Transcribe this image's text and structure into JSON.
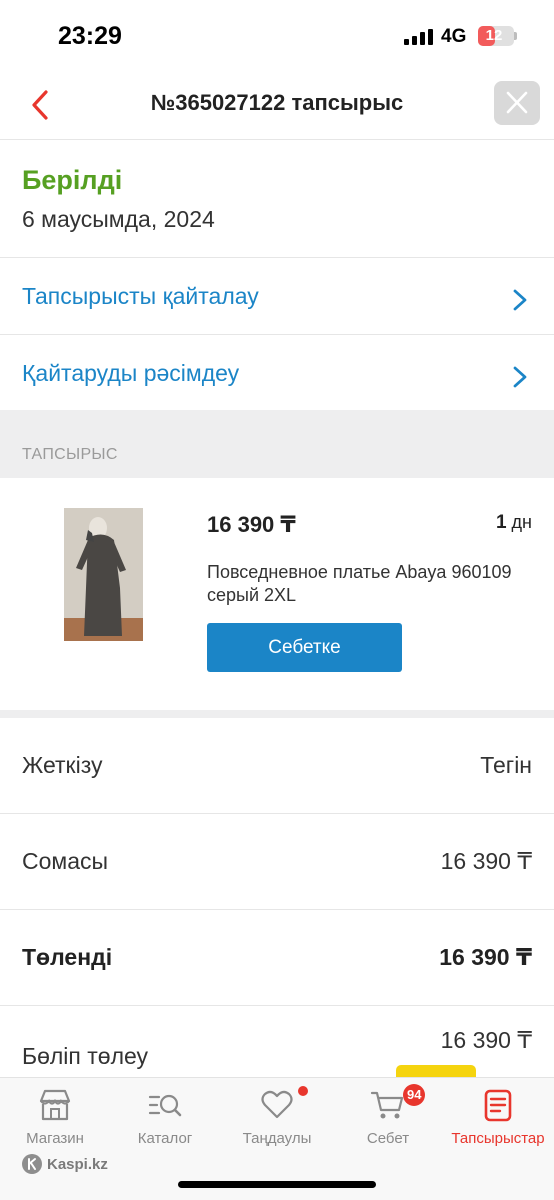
{
  "status_bar": {
    "time": "23:29",
    "network": "4G",
    "battery": "12",
    "battery_level": 0.12
  },
  "header": {
    "title": "№365027122 тапсырыс",
    "back_icon": "chevron-left-icon",
    "close_icon": "close-icon"
  },
  "order": {
    "status": "Берілді",
    "date": "6 маусымда, 2024",
    "status_color": "#56a022"
  },
  "actions": [
    {
      "label": "Тапсырысты қайталау"
    },
    {
      "label": "Қайтаруды рәсімдеу"
    }
  ],
  "section": {
    "label": "ТАПСЫРЫС"
  },
  "product": {
    "price": "16 390 ₸",
    "qty_number": "1",
    "qty_unit": "дн",
    "name": "Повседневное платье Abaya 960109 серый 2XL",
    "button_label": "Себетке"
  },
  "summary": [
    {
      "label": "Жеткізу",
      "value": "Тегін",
      "bold": false
    },
    {
      "label": "Сомасы",
      "value": "16 390 ₸",
      "bold": false
    },
    {
      "label": "Төленді",
      "value": "16 390 ₸",
      "bold": true
    }
  ],
  "installment": {
    "label": "Бөліп төлеу",
    "value": "16 390 ₸"
  },
  "bottom_nav": {
    "items": [
      {
        "label": "Магазин",
        "icon": "store-icon"
      },
      {
        "label": "Каталог",
        "icon": "catalog-search-icon"
      },
      {
        "label": "Таңдаулы",
        "icon": "heart-icon"
      },
      {
        "label": "Себет",
        "icon": "cart-icon",
        "badge": "94"
      },
      {
        "label": "Тапсырыстар",
        "icon": "orders-icon",
        "active": true
      }
    ]
  },
  "brand": {
    "text": "Kaspi.kz"
  },
  "colors": {
    "accent_blue": "#1b85c7",
    "accent_red": "#e8362d",
    "success_green": "#56a022"
  }
}
